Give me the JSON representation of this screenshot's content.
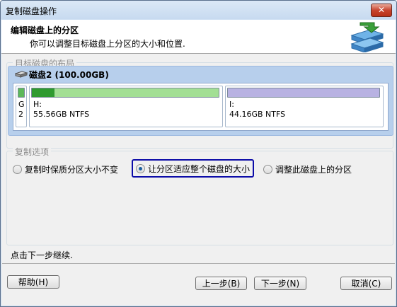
{
  "window": {
    "title": "复制磁盘操作",
    "close_label": "✕"
  },
  "header": {
    "title": "编辑磁盘上的分区",
    "subtitle": "你可以调整目标磁盘上分区的大小和位置.",
    "icon": "disk-copy-icon"
  },
  "layout_group": {
    "label": "目标磁盘的布局",
    "disk": {
      "title": "磁盘2 (100.00GB)",
      "icon": "disk-icon",
      "partitions": [
        {
          "letter": "G",
          "info": "2",
          "fill_percent": 100,
          "color": "#5db85a"
        },
        {
          "letter": "H:",
          "info": "55.56GB NTFS",
          "fill_percent": 12,
          "color": "#2f9a2f",
          "bg": "#a3df94"
        },
        {
          "letter": "I:",
          "info": "44.16GB NTFS",
          "fill_percent": 1,
          "color": "#b8b2e2",
          "bg": "#b8b2e2"
        }
      ]
    }
  },
  "options_group": {
    "label": "复制选项",
    "options": [
      {
        "label": "复制时保质分区大小不变",
        "selected": false
      },
      {
        "label": "让分区适应整个磁盘的大小",
        "selected": true
      },
      {
        "label": "调整此磁盘上的分区",
        "selected": false
      }
    ]
  },
  "hint": "点击下一步继续.",
  "buttons": {
    "help": "帮助(H)",
    "back": "上一步(B)",
    "next": "下一步(N)",
    "cancel": "取消(C)"
  }
}
